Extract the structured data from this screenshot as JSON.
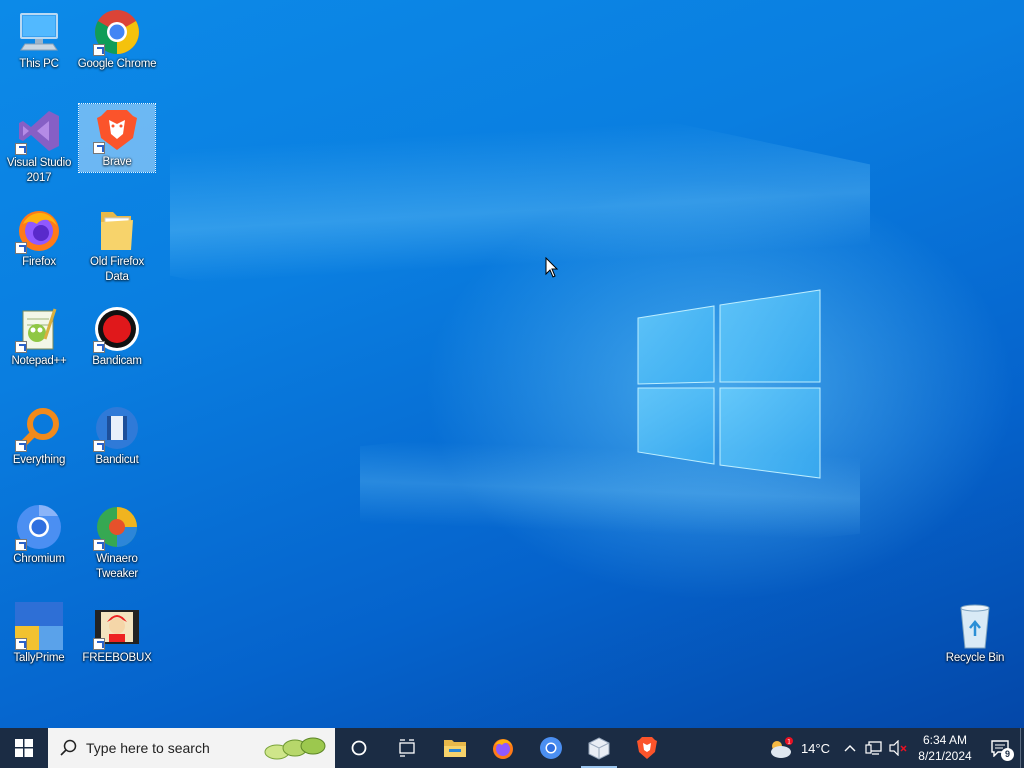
{
  "desktop": {
    "icons_left": [
      {
        "label": "This PC",
        "icon": "this-pc-icon"
      },
      {
        "label": "Google Chrome",
        "icon": "chrome-icon"
      },
      {
        "label": "Visual Studio 2017",
        "icon": "visual-studio-icon"
      },
      {
        "label": "Brave",
        "icon": "brave-icon"
      },
      {
        "label": "Firefox",
        "icon": "firefox-icon"
      },
      {
        "label": "Old Firefox Data",
        "icon": "folder-icon"
      },
      {
        "label": "Notepad++",
        "icon": "notepadpp-icon"
      },
      {
        "label": "Bandicam",
        "icon": "bandicam-icon"
      },
      {
        "label": "Everything",
        "icon": "everything-icon"
      },
      {
        "label": "Bandicut",
        "icon": "bandicut-icon"
      },
      {
        "label": "Chromium",
        "icon": "chromium-icon"
      },
      {
        "label": "Winaero Tweaker",
        "icon": "winaero-icon"
      },
      {
        "label": "TallyPrime",
        "icon": "tallyprime-icon"
      },
      {
        "label": "FREEBOBUX",
        "icon": "freebobux-icon"
      }
    ],
    "recycle_bin": {
      "label": "Recycle Bin",
      "icon": "recycle-bin-icon"
    },
    "selected": "Brave"
  },
  "taskbar": {
    "search_placeholder": "Type here to search",
    "pinned": [
      "file-explorer-icon",
      "firefox-icon",
      "chromium-icon",
      "package-icon",
      "brave-icon"
    ],
    "weather": {
      "temp": "14°C",
      "badge": "1"
    },
    "clock": {
      "time": "6:34 AM",
      "date": "8/21/2024"
    },
    "notification_count": "9"
  },
  "colors": {
    "taskbar": "#1b2c44",
    "wallpaper": "#0a7ee0",
    "search_bg": "#f3f3f3"
  }
}
